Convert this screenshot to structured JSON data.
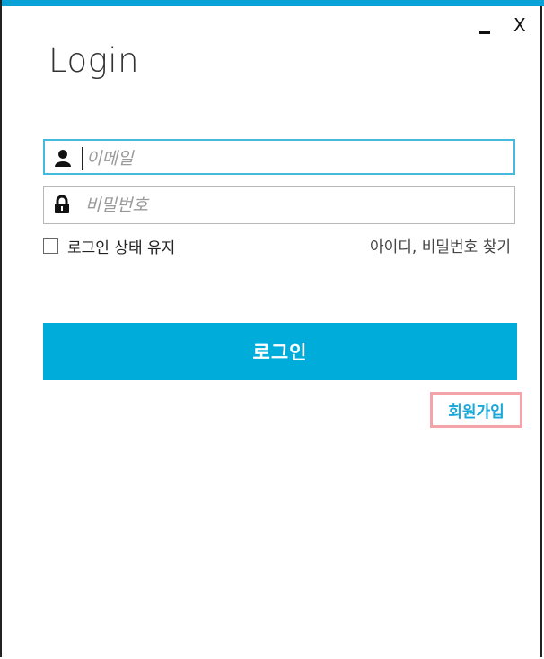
{
  "window": {
    "title": "Login",
    "minimize_label": "",
    "close_label": "X"
  },
  "form": {
    "email_placeholder": "이메일",
    "password_placeholder": "비밀번호",
    "remember_label": "로그인 상태 유지",
    "find_label": "아이디, 비밀번호 찾기",
    "login_button": "로그인",
    "signup_label": "회원가입"
  },
  "colors": {
    "accent": "#00acd9",
    "highlight_border": "#f4a3a8",
    "signup_text": "#1ba8d8"
  }
}
